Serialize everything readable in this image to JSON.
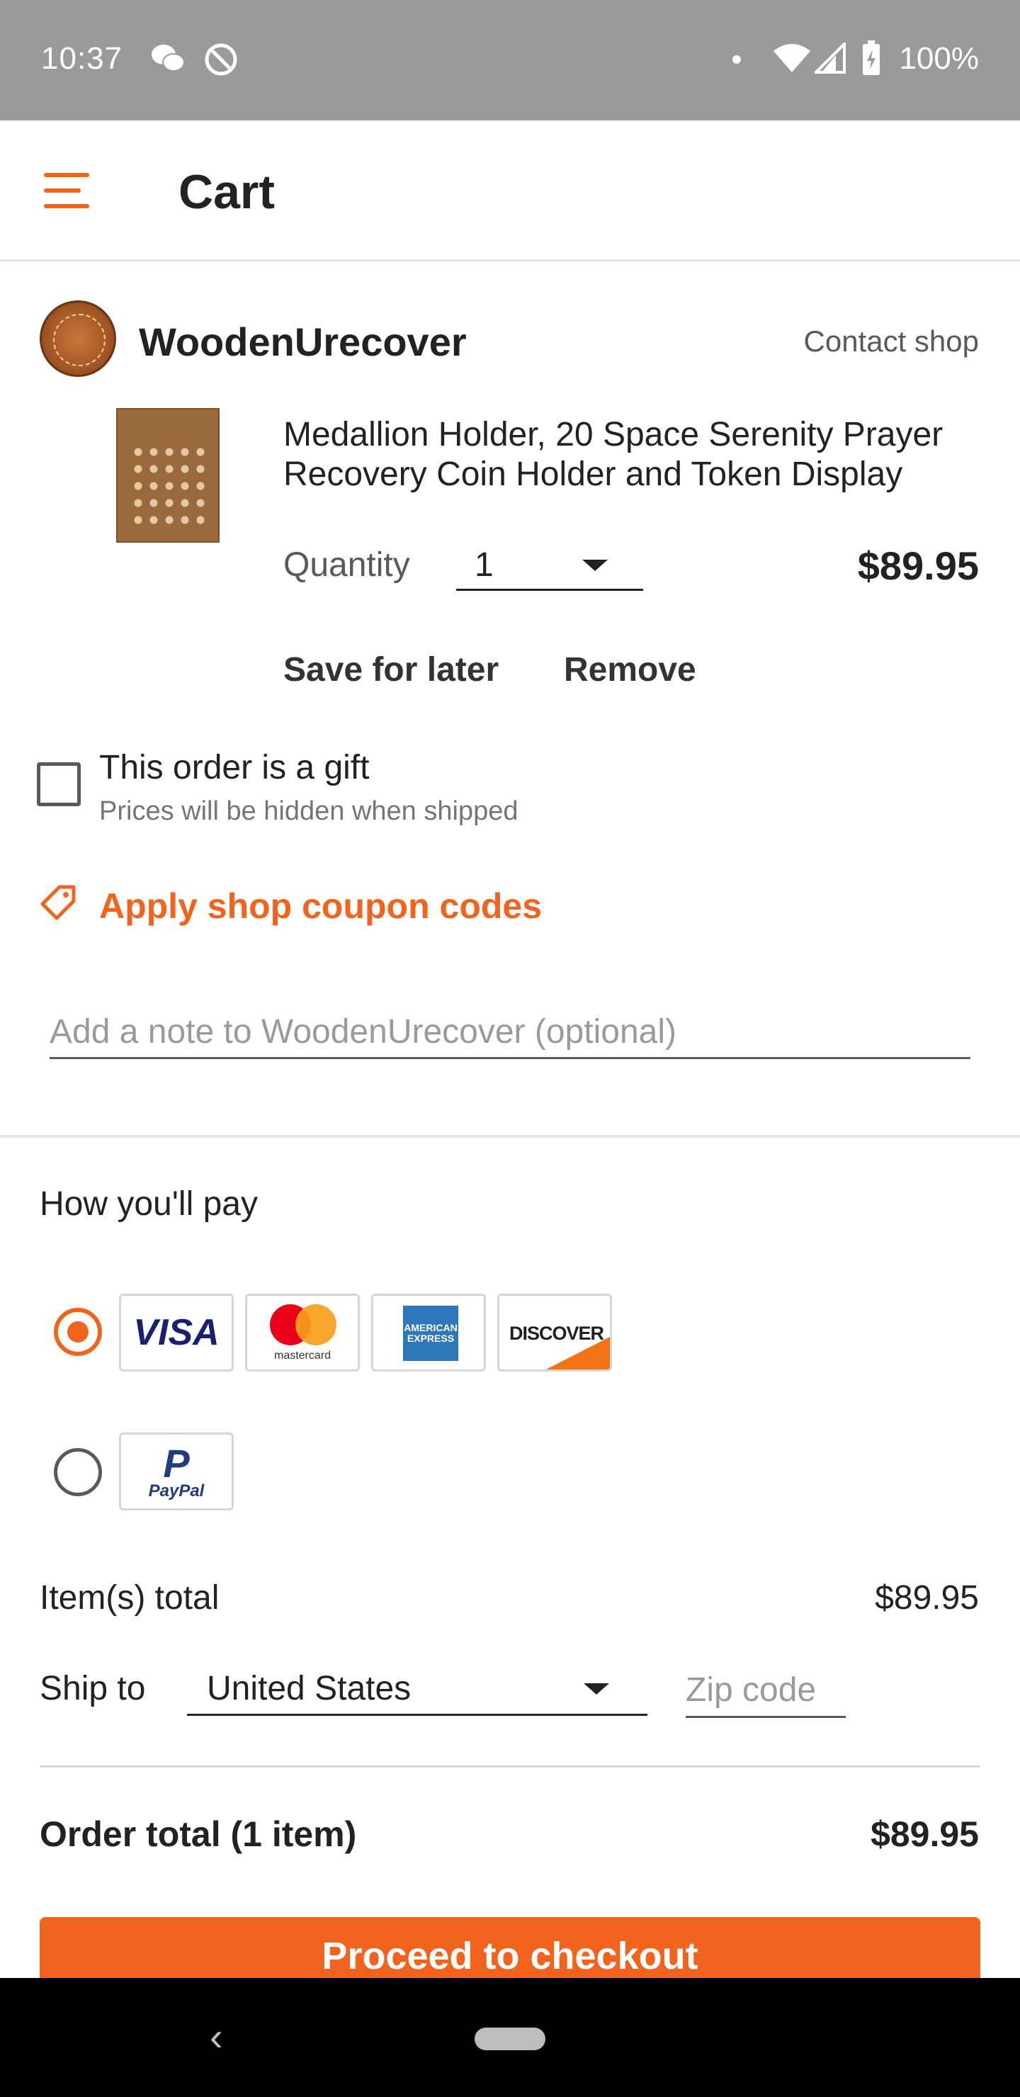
{
  "status_bar": {
    "time": "10:37",
    "battery": "100%",
    "icons": [
      "wechat-icon",
      "at-sign-icon",
      "dot-icon",
      "wifi-icon",
      "signal-icon",
      "battery-charging-icon"
    ]
  },
  "app_bar": {
    "title": "Cart",
    "menu_icon": "hamburger-menu-icon"
  },
  "shop": {
    "name": "WoodenUrecover",
    "contact_label": "Contact shop"
  },
  "item": {
    "title": "Medallion Holder, 20 Space Serenity Prayer Recovery Coin Holder and Token Display",
    "quantity_label": "Quantity",
    "quantity_value": "1",
    "price": "$89.95",
    "save_for_later": "Save for later",
    "remove": "Remove"
  },
  "gift": {
    "label": "This order is a gift",
    "sublabel": "Prices will be hidden when shipped",
    "checked": false
  },
  "coupon": {
    "label": "Apply shop coupon codes"
  },
  "note": {
    "placeholder": "Add a note to WoodenUrecover (optional)",
    "value": ""
  },
  "payment": {
    "title": "How you'll pay",
    "options": [
      {
        "selected": true,
        "cards": [
          "VISA",
          "mastercard",
          "AMERICAN EXPRESS",
          "DISCOVER"
        ]
      },
      {
        "selected": false,
        "cards": [
          "PayPal"
        ]
      }
    ]
  },
  "totals": {
    "items_total_label": "Item(s) total",
    "items_total_value": "$89.95",
    "ship_to_label": "Ship to",
    "ship_to_country": "United States",
    "zip_placeholder": "Zip code",
    "order_total_label": "Order total (1 item)",
    "order_total_value": "$89.95"
  },
  "checkout_button": "Proceed to checkout",
  "colors": {
    "accent": "#f1641e",
    "text": "#222222",
    "muted": "#595959",
    "status_bar": "#9a9a9a"
  }
}
